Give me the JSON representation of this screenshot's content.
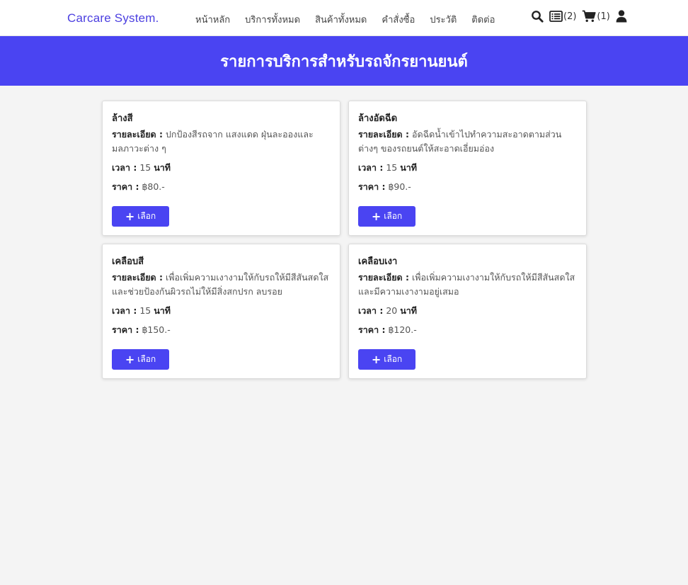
{
  "navbar": {
    "brand": "Carcare System.",
    "links": [
      "หน้าหลัก",
      "บริการทั้งหมด",
      "สินค้าทั้งหมด",
      "คำสั่งซื้อ",
      "ประวัติ",
      "ติดต่อ"
    ],
    "list_count": "(2)",
    "cart_count": "(1)"
  },
  "banner": {
    "title": "รายการบริการสำหรับรถจักรยานยนต์"
  },
  "labels": {
    "detail": "รายละเอียด :",
    "time": "เวลา :",
    "price": "ราคา :",
    "unit": "นาที",
    "button": "เลือก"
  },
  "services": [
    {
      "name": "ล้างสี",
      "detail": "ปกป้องสีรถจาก แสงแดด ฝุ่นละอองและมลภาวะต่าง ๆ",
      "time": "15",
      "price": "฿80.-"
    },
    {
      "name": "ล้างอัดฉีด",
      "detail": "อัดฉีดน้ำเข้าไปทำความสะอาดตามส่วนต่างๆ ของรถยนต์ให้สะอาดเอี่ยมอ่อง",
      "time": "15",
      "price": "฿90.-"
    },
    {
      "name": "เคลือบสี",
      "detail": "เพื่อเพิ่มความเงางามให้กับรถให้มีสีสันสดใส และช่วยป้องกันผิวรถไม่ให้มีสิ่งสกปรก ลบรอย",
      "time": "15",
      "price": "฿150.-"
    },
    {
      "name": "เคลือบเงา",
      "detail": "เพื่อเพิ่มความเงางามให้กับรถให้มีสีสันสดใส และมีความเงางามอยู่เสมอ",
      "time": "20",
      "price": "฿120.-"
    }
  ],
  "colors": {
    "accent": "#4a44f2",
    "brand": "#4b3fe0",
    "background": "#f4f4f4"
  },
  "icons": [
    "search-icon",
    "list-icon",
    "cart-icon",
    "user-icon",
    "plus-icon"
  ]
}
